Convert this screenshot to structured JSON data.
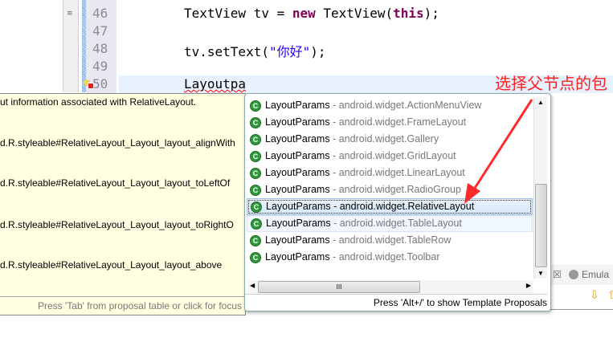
{
  "editor": {
    "line_numbers": [
      "46",
      "47",
      "48",
      "49",
      "50"
    ],
    "lines": {
      "l46_a": "TextView tv = ",
      "l46_kw1": "new",
      "l46_b": " TextView(",
      "l46_kw2": "this",
      "l46_c": ");",
      "l48_a": "tv.setText(",
      "l48_str": "\"你好\"",
      "l48_b": ");",
      "l50": "Layoutpa"
    }
  },
  "tooltip": {
    "lines": [
      "ut information associated with RelativeLayout.",
      "d.R.styleable#RelativeLayout_Layout_layout_alignWith",
      "d.R.styleable#RelativeLayout_Layout_layout_toLeftOf",
      "d.R.styleable#RelativeLayout_Layout_layout_toRightO",
      "d.R.styleable#RelativeLayout_Layout_layout_above"
    ],
    "footer": "Press 'Tab' from proposal table or click for focus"
  },
  "proposals": {
    "items": [
      {
        "name": "LayoutParams",
        "pkg": " - android.widget.ActionMenuView"
      },
      {
        "name": "LayoutParams",
        "pkg": " - android.widget.FrameLayout"
      },
      {
        "name": "LayoutParams",
        "pkg": " - android.widget.Gallery"
      },
      {
        "name": "LayoutParams",
        "pkg": " - android.widget.GridLayout"
      },
      {
        "name": "LayoutParams",
        "pkg": " - android.widget.LinearLayout"
      },
      {
        "name": "LayoutParams",
        "pkg": " - android.widget.RadioGroup"
      },
      {
        "name": "LayoutParams",
        "pkg": " - android.widget.RelativeLayout"
      },
      {
        "name": "LayoutParams",
        "pkg": " - android.widget.TableLayout"
      },
      {
        "name": "LayoutParams",
        "pkg": " - android.widget.TableRow"
      },
      {
        "name": "LayoutParams",
        "pkg": " - android.widget.Toolbar"
      }
    ],
    "selected_index": 6,
    "class_icon": "C",
    "footer": "Press 'Alt+/' to show Template Proposals",
    "hscroll_grip": "III"
  },
  "console": {
    "tab_label": "Emula",
    "close_glyph": "☒"
  },
  "annotation": {
    "text": "选择父节点的包",
    "color": "#ff2020"
  }
}
